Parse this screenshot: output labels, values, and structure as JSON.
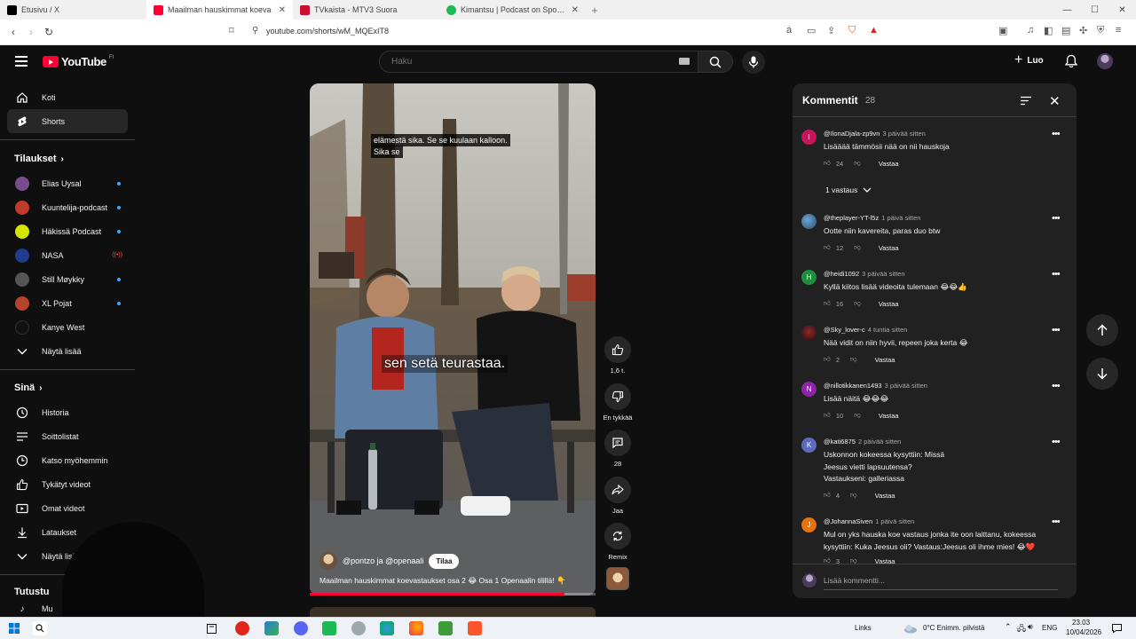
{
  "browser": {
    "tabs": [
      {
        "title": "Etusivu / X",
        "icon_color": "#000000",
        "active": false
      },
      {
        "title": "Maailman hauskimmat koeva",
        "icon_color": "#ff0033",
        "active": true
      },
      {
        "title": "TVkaista - MTV3 Suora",
        "icon_color": "#c8102e",
        "active": false
      },
      {
        "title": "Kimantsu | Podcast on Spotify",
        "icon_color": "#1db954",
        "active": false
      }
    ],
    "new_tab": "+",
    "url": "youtube.com/shorts/wM_MQExIT8"
  },
  "header": {
    "logo_text": "YouTube",
    "logo_region": "FI",
    "search_placeholder": "Haku",
    "create_label": "Luo"
  },
  "sidebar": {
    "home": "Koti",
    "shorts": "Shorts",
    "subscriptions_heading": "Tilaukset",
    "subscriptions": [
      {
        "name": "Elias Uysal",
        "color": "#7a4b8c",
        "badge": "dot"
      },
      {
        "name": "Kuuntelija-podcast",
        "color": "#c0392b",
        "badge": "dot"
      },
      {
        "name": "Häkissä Podcast",
        "color": "#d4e600",
        "badge": "dot"
      },
      {
        "name": "NASA",
        "color": "#1f3c8f",
        "badge": "live"
      },
      {
        "name": "Still Møykky",
        "color": "#555555",
        "badge": "dot"
      },
      {
        "name": "XL Pojat",
        "color": "#b8432b",
        "badge": "dot"
      },
      {
        "name": "Kanye West",
        "color": "#111111",
        "badge": "none"
      }
    ],
    "show_more": "Näytä lisää",
    "you_heading": "Sinä",
    "you_items": [
      "Historia",
      "Soittolistat",
      "Katso myöhemmin",
      "Tykätyt videot",
      "Omat videot",
      "Lataukset",
      "Näytä lisää"
    ],
    "explore_heading": "Tutustu",
    "explore_first": "Mu"
  },
  "video": {
    "caption_line1": "elämestä sika. Se se kuulaan kalloon.",
    "caption_line2": "Sika se",
    "subtitle": "sen setä teurastaa.",
    "channel": "@pontzo ja @openaali",
    "subscribe": "Tilaa",
    "title": "Maailman hauskimmat koevastaukset osa 2 😂 Osa 1 Openaalin tilillä! 👇",
    "progress": 0.89
  },
  "actions": {
    "likes": "1,6 t.",
    "dislike": "En tykkää",
    "comments": "28",
    "share": "Jaa",
    "remix": "Remix"
  },
  "comments": {
    "title": "Kommentit",
    "count": "28",
    "reply_label": "Vastaa",
    "replies_toggle": "1 vastaus",
    "add_placeholder": "Lisää kommentti...",
    "items": [
      {
        "user": "@IlonaDjala-zp9vn",
        "time": "3 päivää sitten",
        "text": "Lisääää tämmösii nää on nii hauskoja",
        "likes": "24",
        "avatar": "I",
        "color": "#c2185b"
      },
      {
        "user": "@theplayer-YT-l5z",
        "time": "1 päivä sitten",
        "text": "Ootte niin kavereita, paras duo btw",
        "likes": "12",
        "avatar": "",
        "color": "#3a6ea5"
      },
      {
        "user": "@heidi1092",
        "time": "3 päivää sitten",
        "text": "Kyllä kiitos lisää videoita tulemaan 😂😂👍",
        "likes": "16",
        "avatar": "H",
        "color": "#1e8e3e"
      },
      {
        "user": "@Sky_lover-c",
        "time": "4 tuntia sitten",
        "text": "Nää vidit on niin hyvii, repeen joka kerta 😂",
        "likes": "2",
        "avatar": "",
        "color": "#5a1a1a"
      },
      {
        "user": "@nillotikkanen1493",
        "time": "3 päivää sitten",
        "text": "Lisää näitä 😂😂😂",
        "likes": "10",
        "avatar": "N",
        "color": "#8e24aa"
      },
      {
        "user": "@kati6875",
        "time": "2 päivää sitten",
        "text": "Uskonnon kokeessa kysyttiin: Missä Jeesus vietti lapsuutensa? Vastaukseni: galleriassa",
        "likes": "4",
        "avatar": "K",
        "color": "#5c6bc0"
      },
      {
        "user": "@JohannaSiven",
        "time": "1 päivä sitten",
        "text": "Mul on yks hauska koe vastaus jonka ite oon laittanu, kokeessa kysyttiin: Kuka Jeesus oli? Vastaus:Jeesus oli ihme mies! 😂❤️",
        "likes": "3",
        "avatar": "J",
        "color": "#e8710a"
      }
    ]
  },
  "taskbar": {
    "links": "Links",
    "weather": "0°C  Enimm. pilvistä",
    "lang": "ENG",
    "time": "23.03",
    "date": "10/04/2026"
  }
}
